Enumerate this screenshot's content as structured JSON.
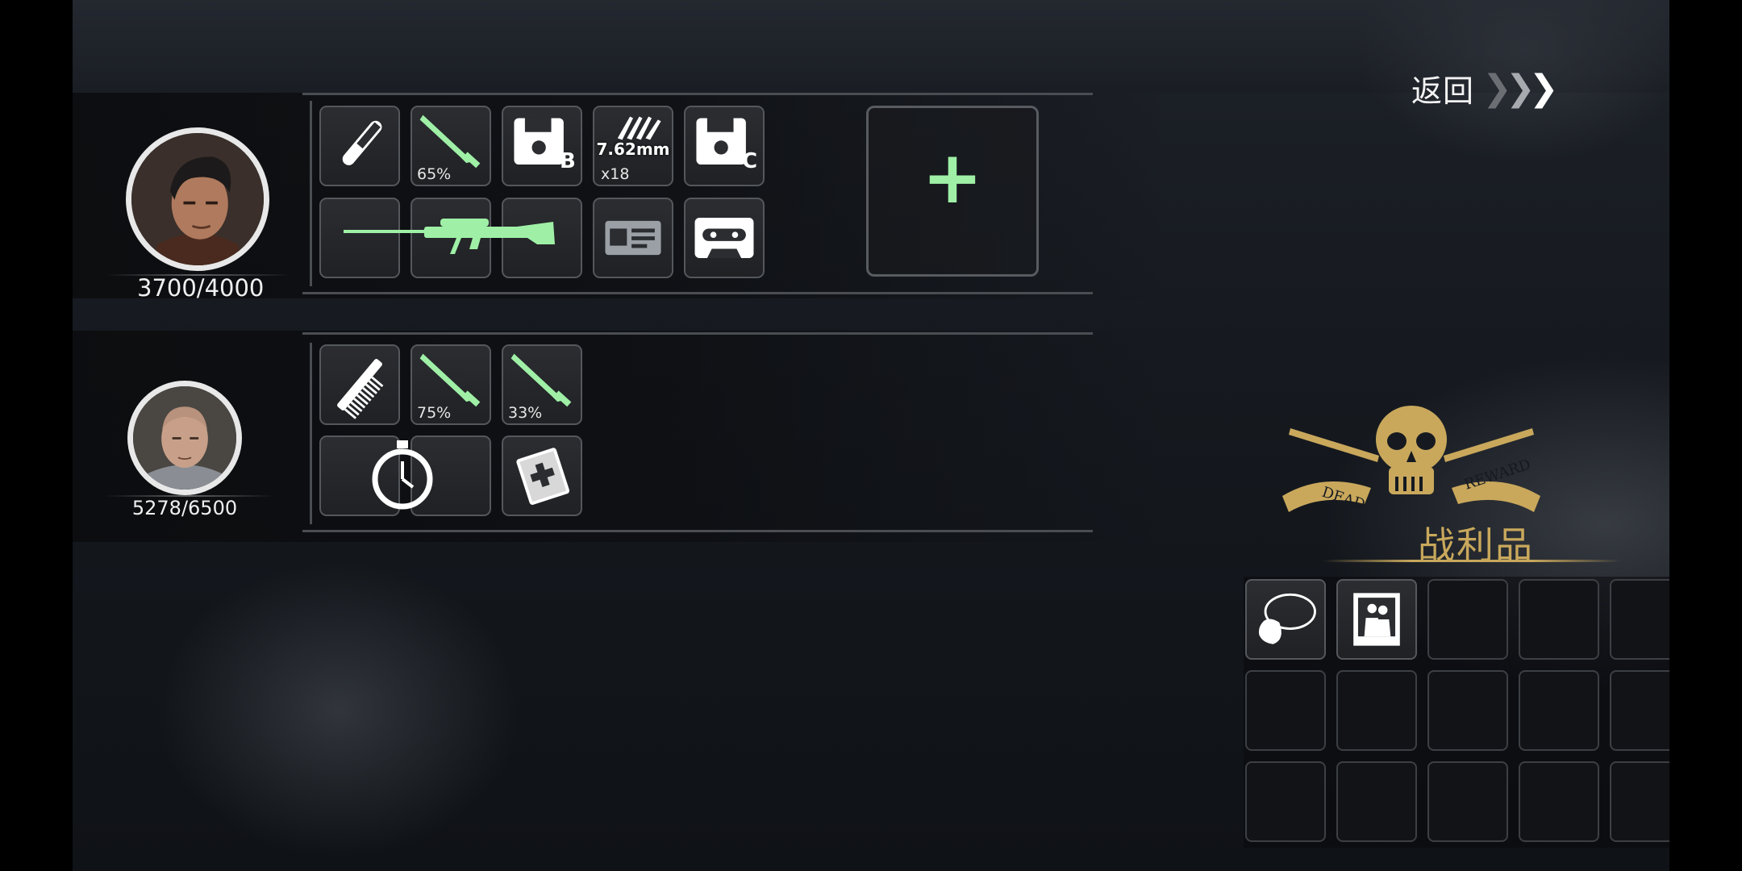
{
  "header": {
    "back_label": "返回",
    "back_icon": "triple-chevron-right-icon"
  },
  "characters": [
    {
      "name": "player-character-1",
      "hp_text": "3700/4000",
      "hp_current": 3700,
      "hp_max": 4000,
      "items": [
        {
          "icon": "test-tube-icon"
        },
        {
          "icon": "combat-knife-icon",
          "durability": "65%"
        },
        {
          "icon": "floppy-disk-icon",
          "grade": "B"
        },
        {
          "icon": "ammo-icon",
          "caliber": "7.62mm",
          "count": "x18"
        },
        {
          "icon": "floppy-disk-icon",
          "grade": "C"
        },
        {
          "icon": "sniper-rifle-icon"
        },
        {
          "icon": "id-card-icon"
        },
        {
          "icon": "cassette-tape-icon"
        }
      ],
      "add_slot_label": "+"
    },
    {
      "name": "player-character-2",
      "hp_text": "5278/6500",
      "hp_current": 5278,
      "hp_max": 6500,
      "items": [
        {
          "icon": "comb-icon"
        },
        {
          "icon": "combat-knife-icon",
          "durability": "75%"
        },
        {
          "icon": "combat-knife-icon",
          "durability": "33%"
        },
        {
          "icon": "stopwatch-icon"
        },
        {
          "icon": "first-aid-book-icon"
        }
      ]
    }
  ],
  "loot": {
    "title": "战利品",
    "emblem_text_left": "DEAD",
    "emblem_text_right": "REWARD",
    "emblem_icon": "skull-crossed-rifles-icon",
    "items": [
      {
        "icon": "necklace-pouch-icon"
      },
      {
        "icon": "photo-icon"
      }
    ],
    "total_slots": 15
  },
  "colors": {
    "accent_green": "#9ff0a6",
    "loot_gold": "#c9a85c",
    "slot_border": "#54575b"
  }
}
